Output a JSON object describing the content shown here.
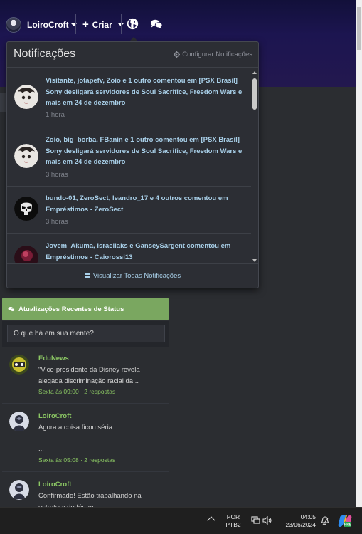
{
  "navbar": {
    "username": "LoiroCroft",
    "create_label": "Criar"
  },
  "notifications": {
    "title": "Notificações",
    "config_label": "Configurar Notificações",
    "items": [
      {
        "text": "Visitante, jotapefv, Zoio e 1 outro comentou em [PSX Brasil] Sony desligará servidores de Soul Sacrifice, Freedom Wars e mais em 24 de dezembro",
        "time": "1 hora",
        "avatar": "anime-avatar"
      },
      {
        "text": "Zoio, big_borba, FBanin e 1 outro comentou em [PSX Brasil] Sony desligará servidores de Soul Sacrifice, Freedom Wars e mais em 24 de dezembro",
        "time": "3 horas",
        "avatar": "anime-avatar"
      },
      {
        "text": "bundo-01, ZeroSect, leandro_17 e 4 outros comentou em Empréstimos - ZeroSect",
        "time": "3 horas",
        "avatar": "skull-avatar"
      },
      {
        "text": "Jovem_Akuma, israellaks e GanseySargent comentou em Empréstimos - Caiorossi13",
        "time": "",
        "avatar": "red-avatar"
      }
    ],
    "footer_label": "Visualizar Todas Notificações"
  },
  "status": {
    "header": "Atualizações Recentes de Status",
    "placeholder": "O que há em sua mente?",
    "feed": [
      {
        "user": "EduNews",
        "text": "\"Vice-presidente da Disney revela alegada discriminação racial da...",
        "meta": "Sexta às 09:00 · 2 respostas"
      },
      {
        "user": "LoiroCroft",
        "text": "Agora a coisa ficou séria...",
        "text2": "...",
        "meta": "Sexta às 05:08 · 2 respostas"
      },
      {
        "user": "LoiroCroft",
        "text": "Confirmado! Estão trabalhando na estrutura do fórum...",
        "meta": ""
      }
    ]
  },
  "taskbar": {
    "lang_line1": "POR",
    "lang_line2": "PTB2",
    "time": "04:05",
    "date": "23/06/2024"
  },
  "colors": {
    "accent_green": "#7aa760",
    "link_blue": "#a8cfe8",
    "user_green": "#8cc864"
  }
}
